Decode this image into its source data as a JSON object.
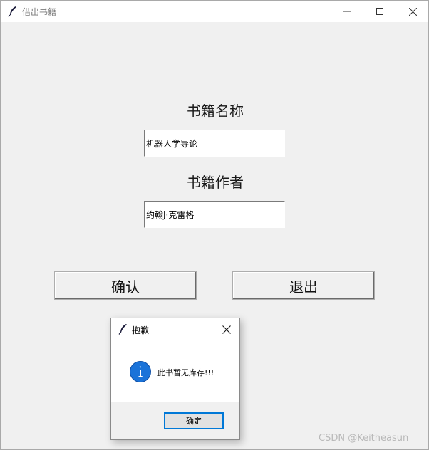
{
  "window": {
    "title": "借出书籍",
    "icon": "feather-icon"
  },
  "form": {
    "name_label": "书籍名称",
    "name_value": "机器人学导论",
    "author_label": "书籍作者",
    "author_value": "约翰J·克雷格",
    "confirm_label": "确认",
    "exit_label": "退出"
  },
  "dialog": {
    "title": "抱歉",
    "icon": "info-icon",
    "message": "此书暂无库存!!!",
    "ok_label": "确定",
    "info_glyph": "i"
  },
  "watermark": "CSDN @Keitheasun",
  "colors": {
    "background": "#f0f0f0",
    "focus_border": "#0078d7",
    "info_blue": "#1a73d9"
  }
}
